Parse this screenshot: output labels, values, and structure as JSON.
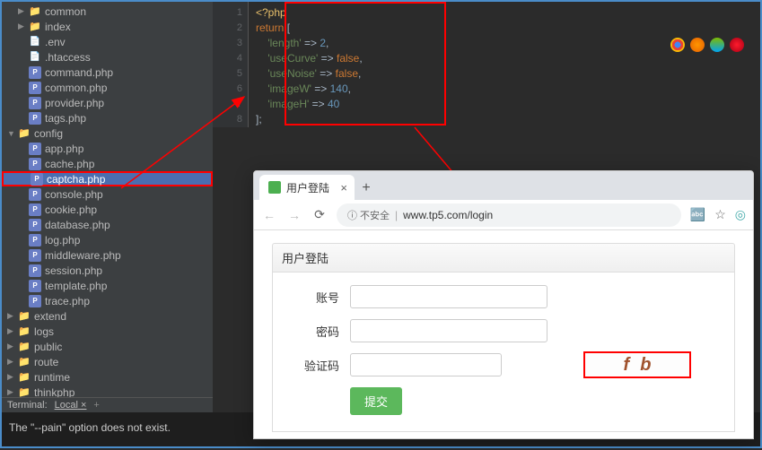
{
  "tree": {
    "common": "common",
    "index": "index",
    "env": ".env",
    "htaccess": ".htaccess",
    "command": "command.php",
    "common_php": "common.php",
    "provider": "provider.php",
    "tags": "tags.php",
    "config": "config",
    "app": "app.php",
    "cache": "cache.php",
    "captcha": "captcha.php",
    "console": "console.php",
    "cookie": "cookie.php",
    "database": "database.php",
    "log": "log.php",
    "middleware": "middleware.php",
    "session": "session.php",
    "template": "template.php",
    "trace": "trace.php",
    "extend": "extend",
    "logs": "logs",
    "public": "public",
    "route": "route",
    "runtime": "runtime",
    "thinkphp": "thinkphp"
  },
  "code": {
    "l1_tag": "<?php",
    "l2_kw": "return",
    "l2_br": " [",
    "l3_key": "'length'",
    "l3_arr": " => ",
    "l3_val": "2",
    "l4_key": "'useCurve'",
    "l4_val": "false",
    "l5_key": "'useNoise'",
    "l5_val": "false",
    "l6_key": "'imageW'",
    "l6_val": "140",
    "l7_key": "'imageH'",
    "l7_val": "40",
    "l8": "];",
    "comma": ","
  },
  "line_numbers": [
    "1",
    "2",
    "3",
    "4",
    "5",
    "6",
    "7",
    "8"
  ],
  "terminal": {
    "tab_label": "Terminal:",
    "local": "Local",
    "close": "×",
    "plus": "+",
    "output": "The \"--pain\" option does not exist."
  },
  "browser": {
    "tab_title": "用户登陆",
    "insecure": "不安全",
    "url": "www.tp5.com/login",
    "page_title": "用户登陆",
    "label_account": "账号",
    "label_password": "密码",
    "label_captcha": "验证码",
    "submit": "提交",
    "captcha_c1": "f",
    "captcha_c2": "b"
  }
}
